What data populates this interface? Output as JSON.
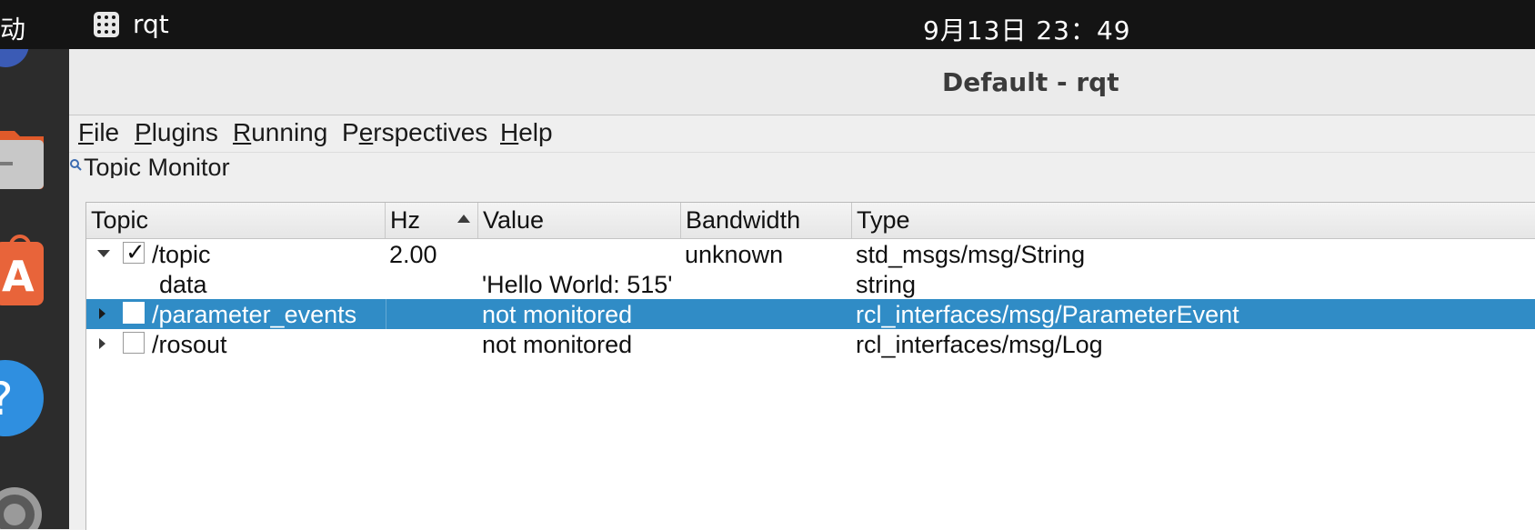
{
  "topbar": {
    "activities": "动",
    "app_name": "rqt",
    "clock": "9月13日  23：49"
  },
  "dock": {
    "items": [
      "files-icon",
      "app-center-icon",
      "help-icon",
      "settings-icon"
    ]
  },
  "window": {
    "title": "Default - rqt"
  },
  "menubar": {
    "items": [
      {
        "mnemonic": "F",
        "rest": "ile"
      },
      {
        "mnemonic": "P",
        "rest": "lugins"
      },
      {
        "mnemonic": "R",
        "rest": "unning"
      },
      {
        "pre": "P",
        "mnemonic": "e",
        "rest": "rspectives"
      },
      {
        "mnemonic": "H",
        "rest": "elp"
      }
    ]
  },
  "plugin": {
    "title": "Topic Monitor"
  },
  "table": {
    "columns": [
      "Topic",
      "Hz",
      "Value",
      "Bandwidth",
      "Type"
    ],
    "sort_column": "Hz",
    "rows": [
      {
        "topic": "/topic",
        "hz": "2.00",
        "value": "",
        "bandwidth": "unknown",
        "type": "std_msgs/msg/String",
        "expanded": true,
        "checked": true,
        "selected": false
      },
      {
        "topic": "data",
        "hz": "",
        "value": "'Hello World: 515'",
        "bandwidth": "",
        "type": "string",
        "child": true
      },
      {
        "topic": "/parameter_events",
        "hz": "",
        "value": "not monitored",
        "bandwidth": "",
        "type": "rcl_interfaces/msg/ParameterEvent",
        "expanded": false,
        "checked": false,
        "selected": true
      },
      {
        "topic": "/rosout",
        "hz": "",
        "value": "not monitored",
        "bandwidth": "",
        "type": "rcl_interfaces/msg/Log",
        "expanded": false,
        "checked": false,
        "selected": false
      }
    ]
  },
  "colors": {
    "selection": "#308cc6",
    "topbar": "#141414",
    "dock": "#2c2c2c"
  }
}
